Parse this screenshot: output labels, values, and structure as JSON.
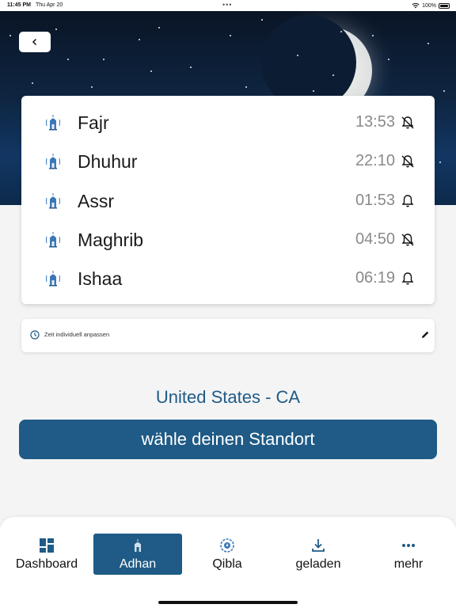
{
  "status_bar": {
    "time": "11:45 PM",
    "date": "Thu Apr 20",
    "battery": "100%"
  },
  "prayers": [
    {
      "name": "Fajr",
      "time": "13:53",
      "bell": "bell-off-icon"
    },
    {
      "name": "Dhuhur",
      "time": "22:10",
      "bell": "bell-off-icon"
    },
    {
      "name": "Assr",
      "time": "01:53",
      "bell": "bell-icon"
    },
    {
      "name": "Maghrib",
      "time": "04:50",
      "bell": "bell-off-icon"
    },
    {
      "name": "Ishaa",
      "time": "06:19",
      "bell": "bell-icon"
    }
  ],
  "adjust": {
    "label": "Zeit individuell anpassen"
  },
  "location": {
    "text": "United States - CA",
    "button_label": "wähle deinen Standort"
  },
  "nav": [
    {
      "label": "Dashboard",
      "icon": "dashboard-icon",
      "active": false
    },
    {
      "label": "Adhan",
      "icon": "mosque-icon",
      "active": true
    },
    {
      "label": "Qibla",
      "icon": "compass-icon",
      "active": false
    },
    {
      "label": "geladen",
      "icon": "download-icon",
      "active": false
    },
    {
      "label": "mehr",
      "icon": "more-icon",
      "active": false
    }
  ],
  "colors": {
    "primary": "#1f5b86",
    "sky_dark": "#0a1526",
    "time_gray": "#8a8a8a",
    "background": "#f4f4f5"
  }
}
